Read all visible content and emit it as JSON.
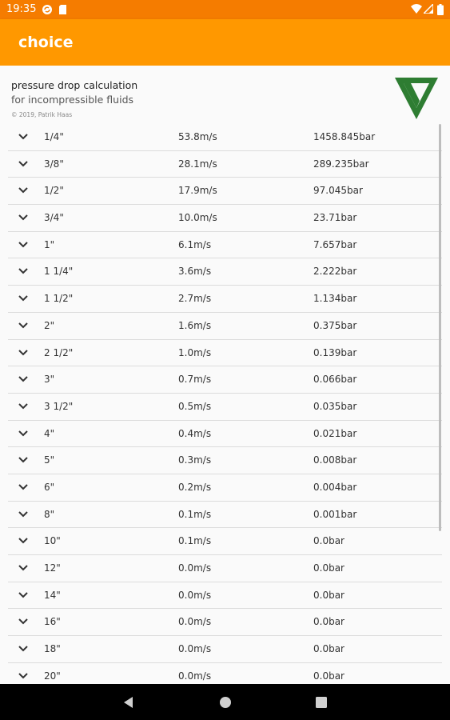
{
  "status_bar": {
    "time": "19:35"
  },
  "app_bar": {
    "title": "choice"
  },
  "header": {
    "title": "pressure drop calculation",
    "subtitle": "for incompressible fluids",
    "copyright": "© 2019, Patrik Haas"
  },
  "rows": [
    {
      "size": "1/4\"",
      "velocity": "53.8m/s",
      "pressure_drop": "1458.845bar"
    },
    {
      "size": "3/8\"",
      "velocity": "28.1m/s",
      "pressure_drop": "289.235bar"
    },
    {
      "size": "1/2\"",
      "velocity": "17.9m/s",
      "pressure_drop": "97.045bar"
    },
    {
      "size": "3/4\"",
      "velocity": "10.0m/s",
      "pressure_drop": "23.71bar"
    },
    {
      "size": "1\"",
      "velocity": "6.1m/s",
      "pressure_drop": "7.657bar"
    },
    {
      "size": "1 1/4\"",
      "velocity": "3.6m/s",
      "pressure_drop": "2.222bar"
    },
    {
      "size": "1 1/2\"",
      "velocity": "2.7m/s",
      "pressure_drop": "1.134bar"
    },
    {
      "size": "2\"",
      "velocity": "1.6m/s",
      "pressure_drop": "0.375bar"
    },
    {
      "size": "2 1/2\"",
      "velocity": "1.0m/s",
      "pressure_drop": "0.139bar"
    },
    {
      "size": "3\"",
      "velocity": "0.7m/s",
      "pressure_drop": "0.066bar"
    },
    {
      "size": "3 1/2\"",
      "velocity": "0.5m/s",
      "pressure_drop": "0.035bar"
    },
    {
      "size": "4\"",
      "velocity": "0.4m/s",
      "pressure_drop": "0.021bar"
    },
    {
      "size": "5\"",
      "velocity": "0.3m/s",
      "pressure_drop": "0.008bar"
    },
    {
      "size": "6\"",
      "velocity": "0.2m/s",
      "pressure_drop": "0.004bar"
    },
    {
      "size": "8\"",
      "velocity": "0.1m/s",
      "pressure_drop": "0.001bar"
    },
    {
      "size": "10\"",
      "velocity": "0.1m/s",
      "pressure_drop": "0.0bar"
    },
    {
      "size": "12\"",
      "velocity": "0.0m/s",
      "pressure_drop": "0.0bar"
    },
    {
      "size": "14\"",
      "velocity": "0.0m/s",
      "pressure_drop": "0.0bar"
    },
    {
      "size": "16\"",
      "velocity": "0.0m/s",
      "pressure_drop": "0.0bar"
    },
    {
      "size": "18\"",
      "velocity": "0.0m/s",
      "pressure_drop": "0.0bar"
    },
    {
      "size": "20\"",
      "velocity": "0.0m/s",
      "pressure_drop": "0.0bar"
    }
  ],
  "colors": {
    "status_bar": "#f57c00",
    "app_bar": "#ff9800",
    "logo_green": "#2e7d32",
    "divider": "#dcdcdc"
  },
  "icons": [
    "sync-icon",
    "sd-card-icon",
    "wifi-icon",
    "signal-icon",
    "battery-icon",
    "chevron-down-icon",
    "logo-icon",
    "back-icon",
    "home-icon",
    "recents-icon"
  ]
}
